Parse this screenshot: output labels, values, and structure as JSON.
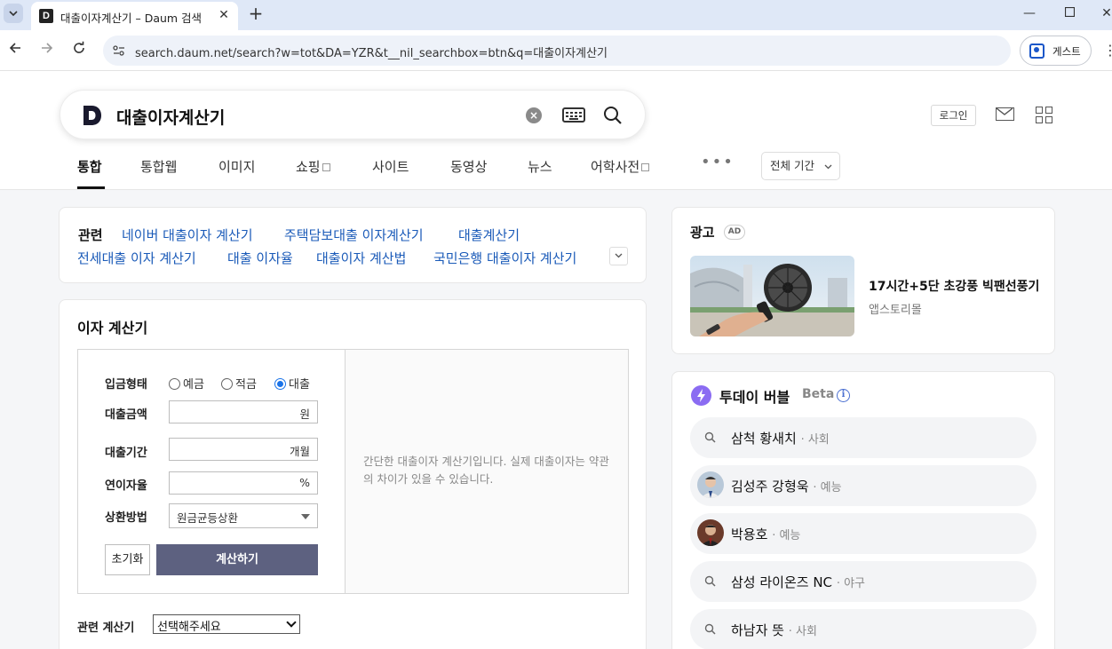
{
  "browser": {
    "tab_title": "대출이자계산기 – Daum 검색",
    "url": "search.daum.net/search?w=tot&DA=YZR&t__nil_searchbox=btn&q=대출이자계산기",
    "guest_label": "게스트"
  },
  "header": {
    "query": "대출이자계산기",
    "login_label": "로그인"
  },
  "tabs": [
    {
      "label": "통합",
      "active": true
    },
    {
      "label": "통합웹"
    },
    {
      "label": "이미지"
    },
    {
      "label": "쇼핑",
      "external": true
    },
    {
      "label": "사이트"
    },
    {
      "label": "동영상"
    },
    {
      "label": "뉴스"
    },
    {
      "label": "어학사전",
      "external": true
    }
  ],
  "more_label": "•••",
  "period_label": "전체 기간",
  "related": {
    "title": "관련",
    "links": [
      "네이버 대출이자 계산기",
      "주택담보대출 이자계산기",
      "대출계산기",
      "전세대출 이자 계산기",
      "대출 이자율",
      "대출이자 계산법",
      "국민은행 대출이자 계산기"
    ]
  },
  "calculator": {
    "title": "이자 계산기",
    "type_label": "입금형태",
    "radio_options": [
      "예금",
      "적금",
      "대출"
    ],
    "selected_option": "대출",
    "amount_label": "대출금액",
    "amount_unit": "원",
    "period_label": "대출기간",
    "period_unit": "개월",
    "rate_label": "연이자율",
    "rate_unit": "%",
    "method_label": "상환방법",
    "method_value": "원금균등상환",
    "reset_label": "초기화",
    "calc_label": "계산하기",
    "description": "간단한 대출이자 계산기입니다. 실제 대출이자는 약관의 차이가 있을 수 있습니다.",
    "related_calc_label": "관련 계산기",
    "related_calc_value": "선택해주세요"
  },
  "ad": {
    "title": "광고",
    "badge": "AD",
    "headline": "17시간+5단 초강풍 빅팬선풍기",
    "source": "앱스토리몰"
  },
  "today_bubble": {
    "title": "투데이 버블",
    "beta": "Beta",
    "items": [
      {
        "keyword": "삼척 황새치",
        "category": "· 사회"
      },
      {
        "keyword": "김성주 강형욱",
        "category": "· 예능"
      },
      {
        "keyword": "박용호",
        "category": "· 예능"
      },
      {
        "keyword": "삼성 라이온즈 NC",
        "category": "· 야구"
      },
      {
        "keyword": "하남자 뜻",
        "category": "· 사회"
      }
    ]
  },
  "colors": {
    "link": "#1a5ab8",
    "calc_button": "#5d6180",
    "bubble_accent": "#8b6cf2"
  }
}
